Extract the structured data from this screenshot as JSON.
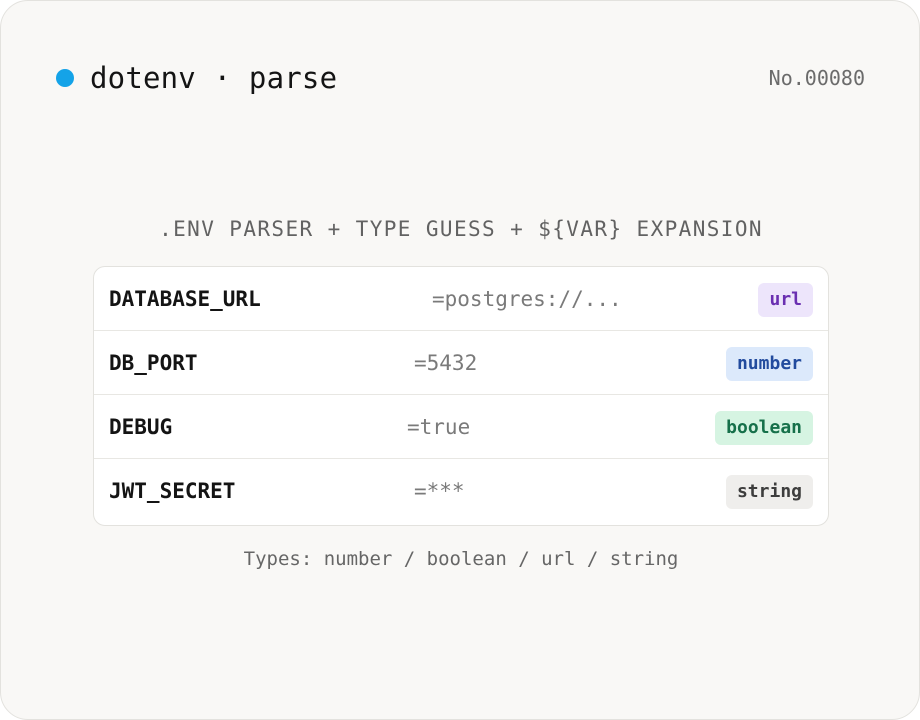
{
  "header": {
    "title": "dotenv · parse",
    "serial": "No.00080",
    "dot_color": "#14a3e8"
  },
  "subtitle": ".ENV PARSER + TYPE GUESS + ${VAR} EXPANSION",
  "rows": [
    {
      "key": "DATABASE_URL",
      "value": "=postgres://...",
      "type": "url"
    },
    {
      "key": "DB_PORT",
      "value": "=5432",
      "type": "number"
    },
    {
      "key": "DEBUG",
      "value": "=true",
      "type": "boolean"
    },
    {
      "key": "JWT_SECRET",
      "value": "=***",
      "type": "string"
    }
  ],
  "footer": "Types: number / boolean / url / string",
  "colors": {
    "url_badge": "#6a2fb1",
    "number_badge": "#224b9e",
    "boolean_badge": "#16704a",
    "string_badge": "#3d3d3d"
  }
}
